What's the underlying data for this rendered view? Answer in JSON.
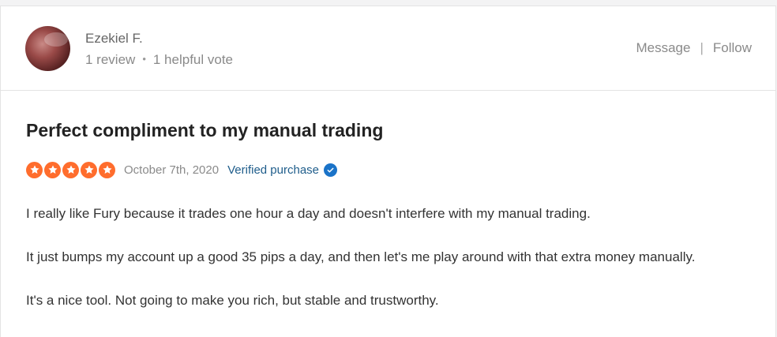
{
  "reviewer": {
    "name": "Ezekiel F.",
    "reviews": "1 review",
    "separator": "•",
    "helpful_votes": "1 helpful vote"
  },
  "actions": {
    "message": "Message",
    "separator": "|",
    "follow": "Follow"
  },
  "review": {
    "title": "Perfect compliment to my manual trading",
    "rating": 5,
    "rating_max": 5,
    "date": "October 7th, 2020",
    "verified_label": "Verified purchase",
    "paragraphs": [
      "I really like Fury because it trades one hour a day and doesn't interfere with my manual trading.",
      "It just bumps my account up a good 35 pips a day, and then let's me play around with that extra money manually.",
      "It's a nice tool. Not going to make you rich, but stable and trustworthy."
    ]
  },
  "colors": {
    "star": "#ff6d2d",
    "verified": "#1f5d8b",
    "check_badge": "#1a73c8"
  },
  "icons": {
    "avatar": "avatar-photo",
    "star": "star-icon",
    "verified": "verified-check-icon"
  }
}
